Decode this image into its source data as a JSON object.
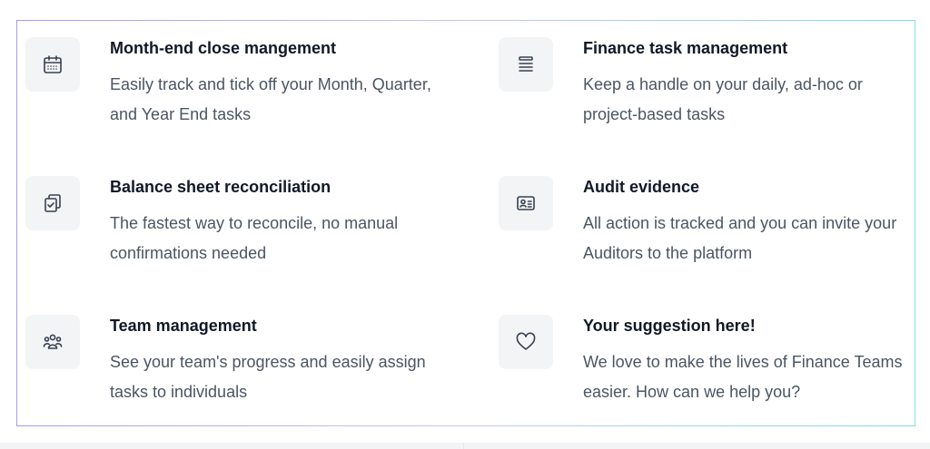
{
  "features": [
    {
      "icon": "calendar-icon",
      "title": "Month-end close mangement",
      "description": "Easily track and tick off your Month, Quarter, and Year End tasks"
    },
    {
      "icon": "list-icon",
      "title": "Finance task management",
      "description": "Keep a handle on your daily, ad-hoc or project-based tasks"
    },
    {
      "icon": "clipboard-check-icon",
      "title": "Balance sheet reconciliation",
      "description": "The fastest way to reconcile, no manual confirmations needed"
    },
    {
      "icon": "id-card-icon",
      "title": "Audit evidence",
      "description": "All action is tracked and you can invite your Auditors to the platform"
    },
    {
      "icon": "team-icon",
      "title": "Team management",
      "description": "See your team's progress and easily assign tasks to individuals"
    },
    {
      "icon": "heart-icon",
      "title": "Your suggestion here!",
      "description": "We love to make the lives of Finance Teams easier. How can we help you?"
    }
  ],
  "colors": {
    "icon_stroke": "#374151",
    "icon_bg": "#f3f4f6",
    "title": "#111827",
    "description": "#4b5563",
    "border_start": "#a79af0",
    "border_end": "#7fe0e0"
  }
}
